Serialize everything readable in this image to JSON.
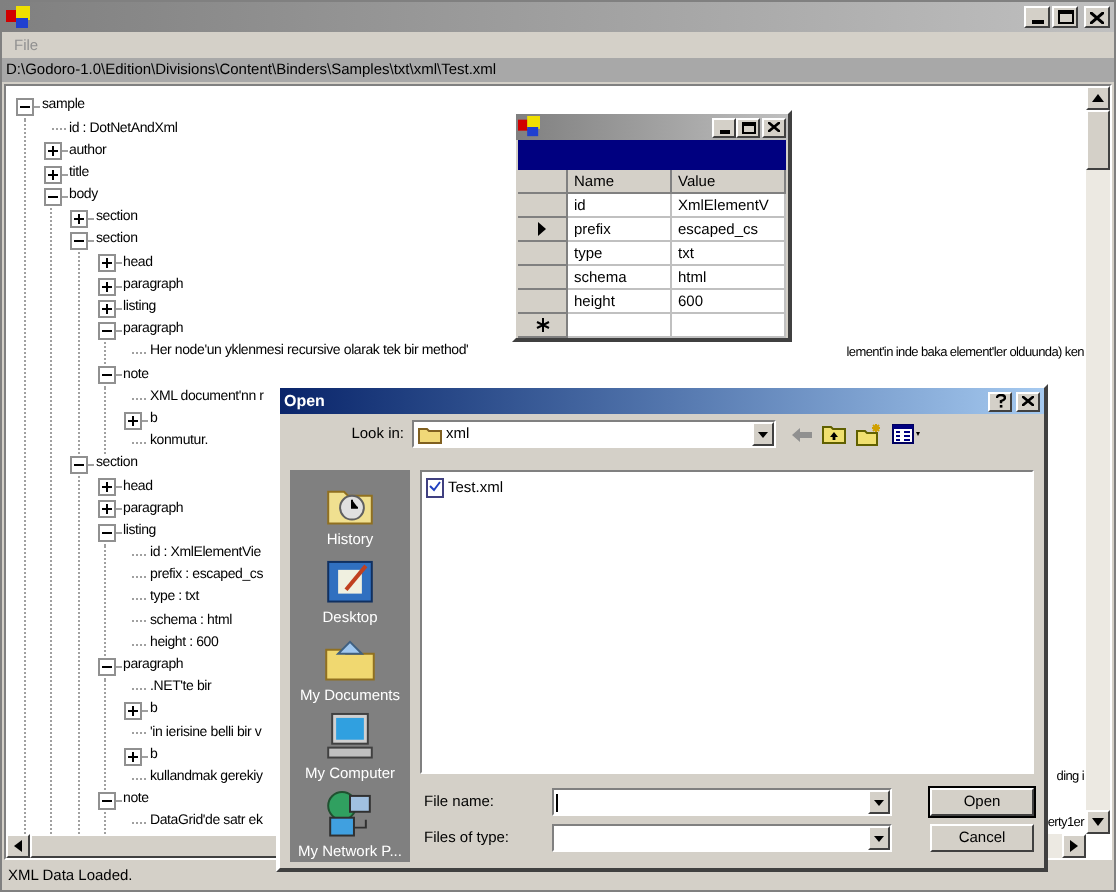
{
  "window": {
    "menu": [
      {
        "label": "File",
        "disabled": true
      }
    ],
    "path": "D:\\Godoro-1.0\\Edition\\Divisions\\Content\\Binders\\Samples\\txt\\xml\\Test.xml"
  },
  "tree": [
    {
      "label": "sample",
      "expanded": true,
      "children": [
        {
          "label": "id : DotNetAndXml"
        },
        {
          "label": "author",
          "expanded": false
        },
        {
          "label": "title",
          "expanded": false
        },
        {
          "label": "body",
          "expanded": true,
          "children": [
            {
              "label": "section",
              "expanded": false
            },
            {
              "label": "section",
              "expanded": true,
              "children": [
                {
                  "label": "head",
                  "expanded": false
                },
                {
                  "label": "paragraph",
                  "expanded": false
                },
                {
                  "label": "listing",
                  "expanded": false
                },
                {
                  "label": "paragraph",
                  "expanded": true,
                  "children": [
                    {
                      "label": "Her node'un yklenmesi recursive olarak tek bir method'",
                      "text_2": "lement'in inde baka element'ler olduunda) ken"
                    }
                  ]
                },
                {
                  "label": "note",
                  "expanded": true,
                  "children": [
                    {
                      "label": "XML document'nn r"
                    },
                    {
                      "label": "b",
                      "expanded": false
                    },
                    {
                      "label": "konmutur."
                    }
                  ]
                }
              ]
            },
            {
              "label": "section",
              "expanded": true,
              "children": [
                {
                  "label": "head",
                  "expanded": false
                },
                {
                  "label": "paragraph",
                  "expanded": false
                },
                {
                  "label": "listing",
                  "expanded": true,
                  "children": [
                    {
                      "label": "id : XmlElementVie"
                    },
                    {
                      "label": "prefix : escaped_cs"
                    },
                    {
                      "label": "type : txt"
                    },
                    {
                      "label": "schema : html"
                    },
                    {
                      "label": "height : 600"
                    }
                  ]
                },
                {
                  "label": "paragraph",
                  "expanded": true,
                  "children": [
                    {
                      "label": ".NET'te bir"
                    },
                    {
                      "label": "b",
                      "expanded": false
                    },
                    {
                      "label": "'in ierisine belli bir v"
                    },
                    {
                      "label": "b",
                      "expanded": false
                    },
                    {
                      "label": "kullandmak gerekiy",
                      "text_2": "ding i"
                    }
                  ]
                },
                {
                  "label": "note",
                  "expanded": true,
                  "children": [
                    {
                      "label": "DataGrid'de satr ek",
                      "text_2": "erty1er"
                    }
                  ]
                }
              ]
            }
          ]
        }
      ]
    }
  ],
  "status_bar": "XML Data Loaded.",
  "grid": {
    "columns": [
      "Name",
      "Value"
    ],
    "rows": [
      {
        "name": "id",
        "value": "XmlElementV",
        "selected": false
      },
      {
        "name": "prefix",
        "value": "escaped_cs",
        "selected": true
      },
      {
        "name": "type",
        "value": "txt",
        "selected": false
      },
      {
        "name": "schema",
        "value": "html",
        "selected": false
      },
      {
        "name": "height",
        "value": "600",
        "selected": false
      }
    ],
    "new_row": true
  },
  "dialog": {
    "title": "Open",
    "look_in_label": "Look in:",
    "look_in": "xml",
    "places": [
      {
        "kind": "history",
        "label": "History"
      },
      {
        "kind": "desktop",
        "label": "Desktop"
      },
      {
        "kind": "documents",
        "label": "My Documents"
      },
      {
        "kind": "computer",
        "label": "My Computer"
      },
      {
        "kind": "network",
        "label": "My Network P..."
      }
    ],
    "files": [
      {
        "name": "Test.xml"
      }
    ],
    "file_name_label": "File name:",
    "files_of_type_label": "Files of type:",
    "buttons": [
      "Open",
      "Cancel"
    ]
  }
}
